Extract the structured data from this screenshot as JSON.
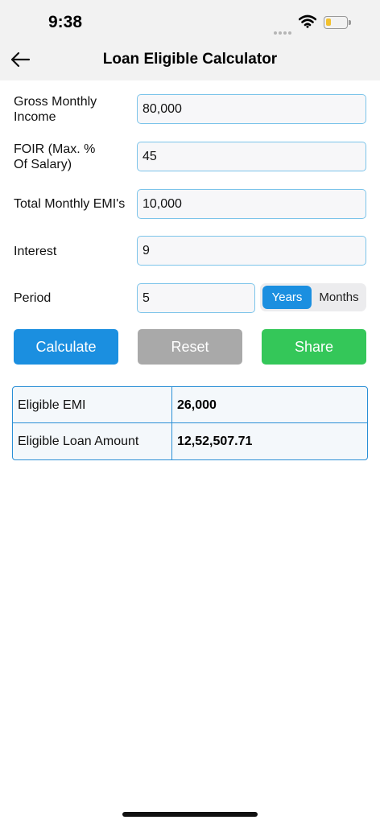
{
  "status_bar": {
    "time": "9:38"
  },
  "nav": {
    "title": "Loan Eligible Calculator"
  },
  "form": {
    "gross_income": {
      "label": "Gross Monthly\nIncome",
      "value": "80,000"
    },
    "foir": {
      "label": "FOIR (Max. %\nOf Salary)",
      "value": "45"
    },
    "total_emi": {
      "label": "Total Monthly EMI's",
      "value": "10,000"
    },
    "interest": {
      "label": "Interest",
      "value": "9"
    },
    "period": {
      "label": "Period",
      "value": "5"
    },
    "period_unit": {
      "options": [
        "Years",
        "Months"
      ],
      "selected": "Years"
    }
  },
  "buttons": {
    "calculate": "Calculate",
    "reset": "Reset",
    "share": "Share"
  },
  "results": {
    "rows": [
      {
        "label": "Eligible EMI",
        "value": "26,000"
      },
      {
        "label": "Eligible Loan Amount",
        "value": "12,52,507.71"
      }
    ]
  },
  "colors": {
    "accent": "#1b8fe0",
    "reset": "#a9a9a9",
    "share": "#34c759",
    "input_border": "#7cc4ea"
  },
  "icons": {
    "back": "arrow-left-icon",
    "wifi": "wifi-icon",
    "battery": "battery-icon",
    "signal": "cellular-signal-icon"
  }
}
